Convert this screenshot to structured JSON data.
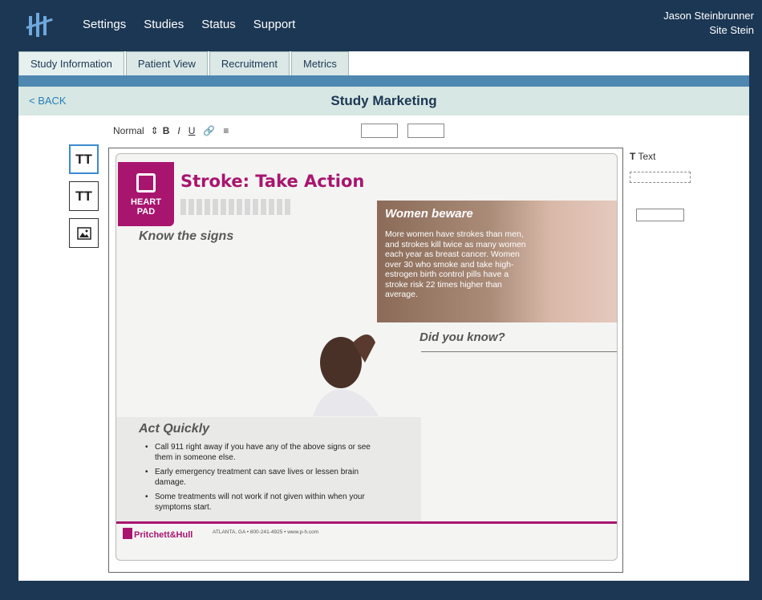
{
  "topbar": {
    "nav": [
      "Settings",
      "Studies",
      "Status",
      "Support"
    ],
    "user_name": "Jason Steinbrunner",
    "user_site": "Site Stein"
  },
  "tabs": [
    "Study Information",
    "Patient View",
    "Recruitment",
    "Metrics"
  ],
  "subheader": {
    "back_label": "< BACK",
    "title": "Study Marketing"
  },
  "toolbar": {
    "style_select": "Normal",
    "bold": "B",
    "italic": "I",
    "underline": "U"
  },
  "tools": {
    "text_tool_label": "TT",
    "text_tool2_label": "TT"
  },
  "flyer": {
    "brand_line1": "HEART",
    "brand_line2": "PAD",
    "title": "Stroke: Take Action",
    "know": "Know the signs",
    "women_title": "Women beware",
    "women_body": "More women have strokes than men, and strokes kill twice as many women each year as breast cancer. Women over 30 who smoke and take high-estrogen birth control pills have a stroke risk 22 times higher than average.",
    "did_you_know": "Did you know?",
    "act_title": "Act Quickly",
    "act_items": [
      "Call 911 right away if you have any of the above signs or see them in someone else.",
      "Early emergency treatment can save lives or lessen brain damage.",
      "Some treatments will not work if not given within when your symptoms start."
    ],
    "footer_brand": "Pritchett&Hull",
    "footer_small": "ATLANTA, GA • 800-241-4925 • www.p-h.com"
  },
  "right_panel": {
    "text_label": "Text"
  }
}
